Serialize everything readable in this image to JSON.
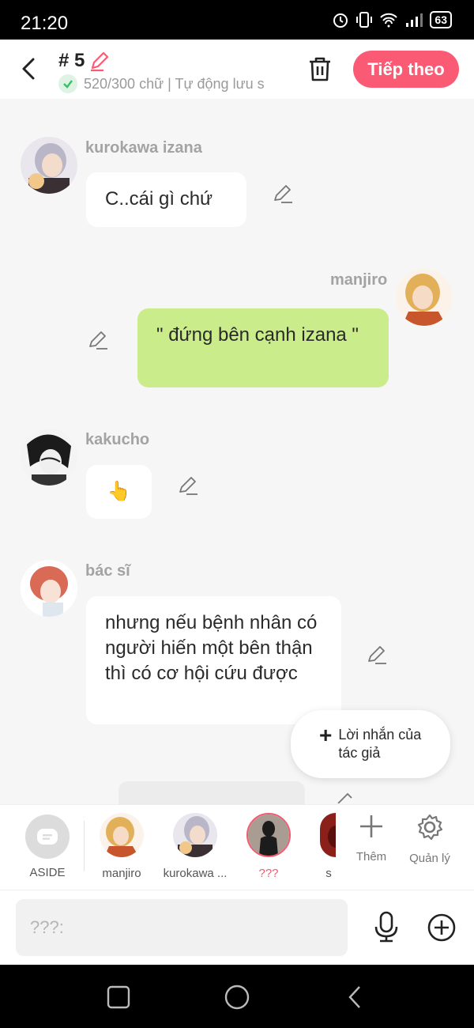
{
  "status": {
    "time": "21:20",
    "battery": "63"
  },
  "header": {
    "chapter": "# 5",
    "word_info": "520/300 chữ | Tự động lưu s",
    "next_label": "Tiếp theo"
  },
  "messages": [
    {
      "name": "kurokawa izana",
      "text": "C..cái gì chứ"
    },
    {
      "name": "manjiro",
      "text": "\" đứng bên cạnh izana \""
    },
    {
      "name": "kakucho",
      "text": "👆"
    },
    {
      "name": "bác sĩ",
      "text": "nhưng nếu bệnh nhân có người hiến một bên thận thì có cơ hội cứu được"
    }
  ],
  "author_note": {
    "label": "Lời nhắn của tác giả"
  },
  "characters": {
    "aside_label": "ASIDE",
    "items": [
      {
        "label": "manjiro"
      },
      {
        "label": "kurokawa ..."
      },
      {
        "label": "???"
      },
      {
        "label": "s"
      }
    ],
    "add_label": "Thêm",
    "manage_label": "Quản lý"
  },
  "input": {
    "placeholder": "???:"
  },
  "colors": {
    "accent": "#fa5a73",
    "green_bubble": "#cbec8a"
  }
}
